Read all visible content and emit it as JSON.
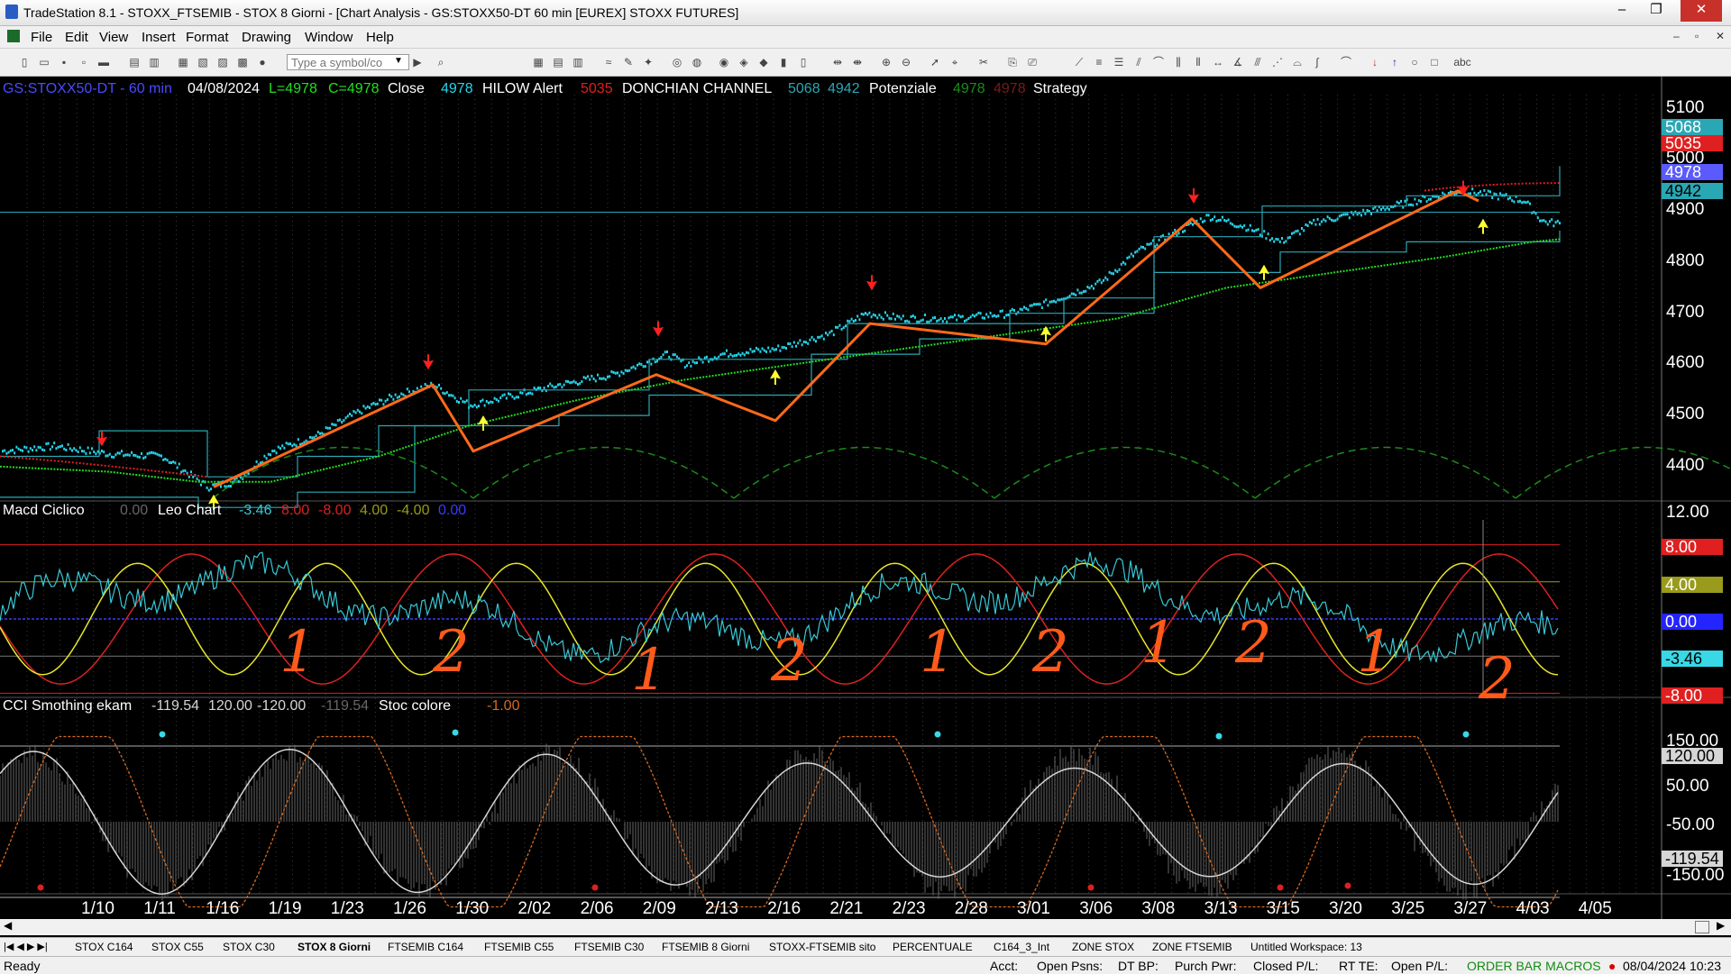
{
  "window": {
    "title": "TradeStation 8.1 - STOXX_FTSEMIB - STOX  8 Giorni - [Chart Analysis - GS:STOXX50-DT  60 min  [EUREX] STOXX FUTURES]",
    "minimize": "–",
    "restore": "❐",
    "close": "✕"
  },
  "menu": {
    "items": [
      "File",
      "Edit",
      "View",
      "Insert",
      "Format",
      "Drawing",
      "Window",
      "Help"
    ],
    "mdi": {
      "minimize": "–",
      "restore": "▫",
      "close": "✕"
    }
  },
  "toolbar": {
    "symbol_placeholder": "Type a symbol/co"
  },
  "chart": {
    "header": {
      "symbol": "GS:STOXX50-DT - 60 min",
      "date": "04/08/2024",
      "low": "L=4978",
      "close": "C=4978",
      "close_label": "Close",
      "close_value": "4978",
      "hilow_label": "HILOW Alert",
      "hilow_value": "5035",
      "donchian_label": "DONCHIAN CHANNEL",
      "donchian_upper": "5068",
      "donchian_lower": "4942",
      "potenziale_label": "Potenziale",
      "potenziale_value1": "4978",
      "potenziale_value2": "4978",
      "strategy_label": "Strategy"
    },
    "macd_header": {
      "name": "Macd Ciclico",
      "value": "0.00",
      "leo_label": "Leo Chart",
      "v1": "-3.46",
      "v2": "8.00",
      "v3": "-8.00",
      "v4": "4.00",
      "v5": "-4.00",
      "v6": "0.00"
    },
    "cci_header": {
      "name": "CCI Smothing ekam",
      "v1": "-119.54",
      "v2": "120.00",
      "v3": "-120.00",
      "v4": "-119.54",
      "stoc_label": "Stoc colore",
      "stoc_value": "-1.00"
    },
    "price_axis": [
      "5100",
      "5000",
      "4900",
      "4800",
      "4700",
      "4600",
      "4500",
      "4400"
    ],
    "price_tags": {
      "t1": "5068",
      "t2": "5035",
      "t3": "4978",
      "t4": "4942"
    },
    "macd_axis": {
      "top": "12.00",
      "t8": "8.00",
      "t4": "4.00",
      "t0": "0.00",
      "cur": "-3.46",
      "tm8": "-8.00"
    },
    "cci_axis": {
      "a150": "150.00",
      "a120": "120.00",
      "a50": "50.00",
      "am50": "-50.00",
      "cur": "-119.54",
      "am150": "-150.00"
    },
    "x_labels": [
      "1/10",
      "1/11",
      "1/16",
      "1/19",
      "1/23",
      "1/26",
      "1/30",
      "2/02",
      "2/06",
      "2/09",
      "2/13",
      "2/16",
      "2/21",
      "2/23",
      "2/28",
      "3/01",
      "3/06",
      "3/08",
      "3/13",
      "3/15",
      "3/20",
      "3/25",
      "3/27",
      "4/03",
      "4/05"
    ],
    "handwriting": [
      "1",
      "2",
      "1",
      "2",
      "1",
      "2",
      "1",
      "2",
      "1",
      "2"
    ],
    "colors": {
      "price": "#27d4ea",
      "strategy": "#ff6a1a",
      "ma": "#22dd22",
      "channel": "#2aa7b4",
      "hilow": "#e02020",
      "cycle": "#1c8a1c",
      "macd_red": "#dd2020",
      "macd_yellow": "#e6e62a",
      "macd_cyan": "#38c8d6",
      "cci_white": "#d6d6d6",
      "cci_stoc": "#d86a1e",
      "cci_red": "#dd2020"
    }
  },
  "tabs": [
    "STOX C164",
    "STOX C55",
    "STOX  C30",
    "STOX  8 Giorni",
    "FTSEMIB C164",
    "FTSEMIB C55",
    "FTSEMIB C30",
    "FTSEMIB  8 Giorni",
    "STOXX-FTSEMIB sito",
    "PERCENTUALE",
    "C164_3_Int",
    "ZONE STOX",
    "ZONE FTSEMIB",
    "Untitled Workspace:  13"
  ],
  "status": {
    "ready": "Ready",
    "acct": "Acct:",
    "open_psns": "Open Psns:",
    "dt_bp": "DT BP:",
    "purch_pwr": "Purch Pwr:",
    "closed_pl": "Closed P/L:",
    "rt_te": "RT TE:",
    "open_pl": "Open P/L:",
    "macros": "ORDER BAR  MACROS",
    "datetime": "08/04/2024 10:23"
  }
}
